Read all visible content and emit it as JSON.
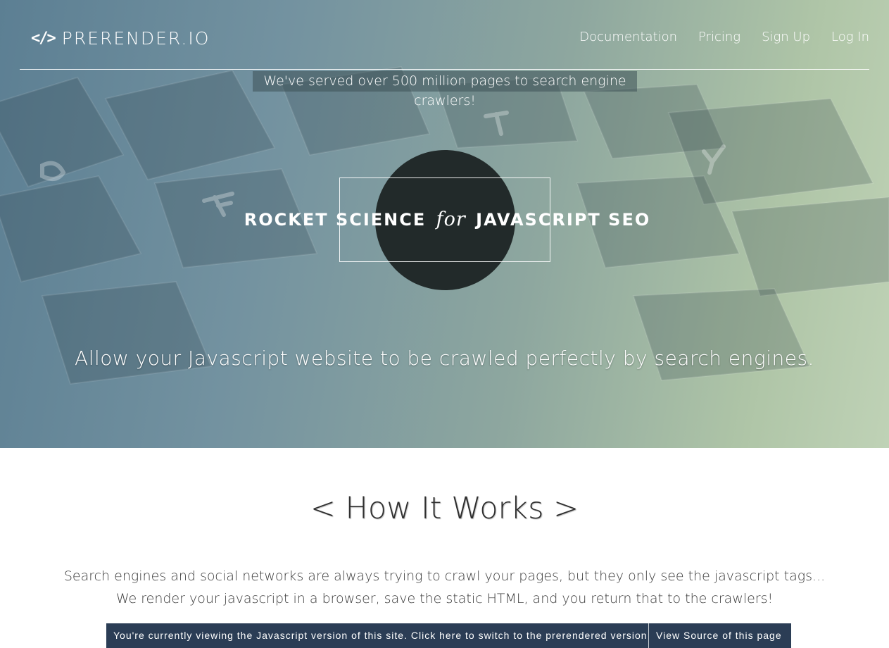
{
  "header": {
    "logo_code": "</>",
    "logo_text": "PRERENDER.IO",
    "nav": [
      "Documentation",
      "Pricing",
      "Sign Up",
      "Log In"
    ]
  },
  "hero": {
    "served_banner": "We've served over 500 million pages to search engine crawlers!",
    "tagline_left": "ROCKET SCIENCE",
    "tagline_for": "for",
    "tagline_right": "JAVASCRIPT SEO",
    "subheading": "Allow your Javascript  website to be crawled perfectly by search engines."
  },
  "how_it_works": {
    "title": "< How It Works >",
    "line1": "Search engines and social networks are always trying to crawl your pages, but they only see the javascript tags...",
    "line2": "We render your javascript in a browser, save the static HTML, and you return that to the crawlers!"
  },
  "bottom_bar": {
    "switch_text": "You're currently viewing the Javascript version of this site. Click here to switch to the prerendered version",
    "view_source": "View Source of this page"
  }
}
